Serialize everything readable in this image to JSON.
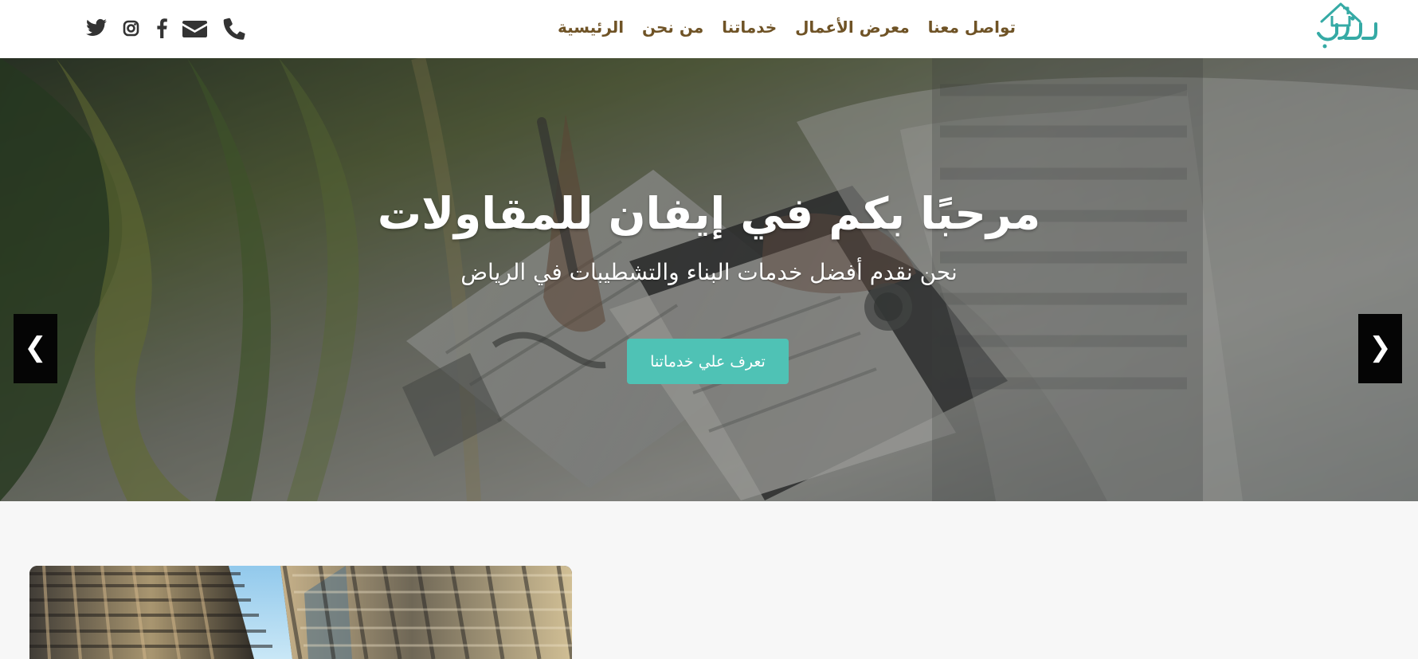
{
  "header": {
    "logo_text": "إيفان",
    "nav": [
      {
        "label": "الرئيسية"
      },
      {
        "label": "من نحن"
      },
      {
        "label": "خدماتنا"
      },
      {
        "label": "معرض الأعمال"
      },
      {
        "label": "تواصل معنا"
      }
    ],
    "social_icons": [
      "twitter-icon",
      "instagram-icon",
      "facebook-icon",
      "mail-icon",
      "phone-icon"
    ]
  },
  "hero": {
    "title": "مرحبًا بكم في إيفان للمقاولات",
    "subtitle": "نحن نقدم أفضل خدمات البناء والتشطيبات في الرياض",
    "button_label": "تعرف علي خدماتنا",
    "prev_label": "❮",
    "next_label": "❯"
  },
  "colors": {
    "nav_text": "#6f5326",
    "accent": "#4fc2b5",
    "hero_text": "#ffffff",
    "logo": "#35aaa5"
  }
}
